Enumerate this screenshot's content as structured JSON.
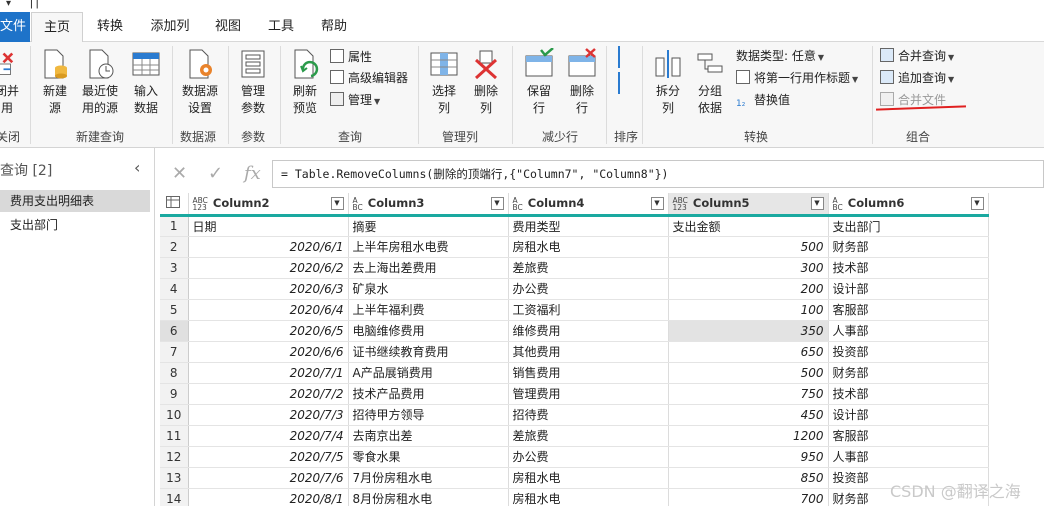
{
  "titlebar": {
    "qa_left": "▾",
    "qa_right": "⌈⌉"
  },
  "menu": {
    "file": "文件",
    "tabs": [
      "主页",
      "转换",
      "添加列",
      "视图",
      "工具",
      "帮助"
    ]
  },
  "ribbon": {
    "close": {
      "label": "闭并\n用",
      "group": "关闭"
    },
    "new_query": {
      "new_source": "新建\n源",
      "recent_sources": "最近使\n用的源",
      "enter_data": "输入\n数据",
      "group": "新建查询"
    },
    "data_source": {
      "settings": "数据源\n设置",
      "group": "数据源"
    },
    "params": {
      "manage": "管理\n参数",
      "group": "参数"
    },
    "query": {
      "refresh": "刷新\n预览",
      "properties": "属性",
      "advanced_editor": "高级编辑器",
      "manage": "管理",
      "group": "查询"
    },
    "manage_columns": {
      "choose": "选择\n列",
      "remove": "删除\n列",
      "group": "管理列"
    },
    "reduce_rows": {
      "keep": "保留\n行",
      "remove": "删除\n行",
      "group": "减少行"
    },
    "sort": {
      "group": "排序"
    },
    "transform": {
      "split": "拆分\n列",
      "group_by": "分组\n依据",
      "data_type": "数据类型: 任意",
      "first_row_header": "将第一行用作标题",
      "replace_values": "替换值",
      "group": "转换"
    },
    "combine": {
      "merge": "合并查询",
      "append": "追加查询",
      "combine_files": "合并文件",
      "group": "组合"
    }
  },
  "queries": {
    "header": "查询 [2]",
    "items": [
      "费用支出明细表",
      "支出部门"
    ]
  },
  "formula_bar": {
    "formula": "= Table.RemoveColumns(删除的顶端行,{\"Column7\", \"Column8\"})"
  },
  "grid": {
    "columns": [
      {
        "type": "ABC\n123",
        "name": "Column2"
      },
      {
        "type": "A\nBC",
        "name": "Column3"
      },
      {
        "type": "A\nBC",
        "name": "Column4"
      },
      {
        "type": "ABC\n123",
        "name": "Column5"
      },
      {
        "type": "A\nBC",
        "name": "Column6"
      }
    ],
    "rows": [
      [
        "1",
        "日期",
        "摘要",
        "费用类型",
        "支出金额",
        "支出部门"
      ],
      [
        "2",
        "2020/6/1",
        "上半年房租水电费",
        "房租水电",
        "500",
        "财务部"
      ],
      [
        "3",
        "2020/6/2",
        "去上海出差费用",
        "差旅费",
        "300",
        "技术部"
      ],
      [
        "4",
        "2020/6/3",
        "矿泉水",
        "办公费",
        "200",
        "设计部"
      ],
      [
        "5",
        "2020/6/4",
        "上半年福利费",
        "工资福利",
        "100",
        "客服部"
      ],
      [
        "6",
        "2020/6/5",
        "电脑维修费用",
        "维修费用",
        "350",
        "人事部"
      ],
      [
        "7",
        "2020/6/6",
        "证书继续教育费用",
        "其他费用",
        "650",
        "投资部"
      ],
      [
        "8",
        "2020/7/1",
        "A产品展销费用",
        "销售费用",
        "500",
        "财务部"
      ],
      [
        "9",
        "2020/7/2",
        "技术产品费用",
        "管理费用",
        "750",
        "技术部"
      ],
      [
        "10",
        "2020/7/3",
        "招待甲方领导",
        "招待费",
        "450",
        "设计部"
      ],
      [
        "11",
        "2020/7/4",
        "去南京出差",
        "差旅费",
        "1200",
        "客服部"
      ],
      [
        "12",
        "2020/7/5",
        "零食水果",
        "办公费",
        "950",
        "人事部"
      ],
      [
        "13",
        "2020/7/6",
        "7月份房租水电",
        "房租水电",
        "850",
        "投资部"
      ],
      [
        "14",
        "2020/8/1",
        "8月份房租水电",
        "房租水电",
        "700",
        "财务部"
      ]
    ]
  },
  "watermark": "CSDN @翻译之海",
  "colors": {
    "accent": "#1e73c9",
    "header_rule": "#1aa9a0",
    "annotation": "#e02020"
  }
}
